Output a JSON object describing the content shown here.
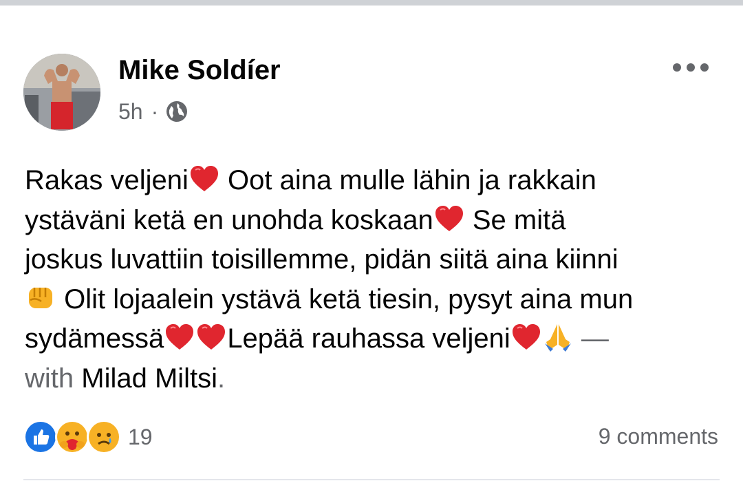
{
  "post": {
    "author": "Mike Soldíer",
    "time": "5h",
    "separator": "·",
    "privacy_icon": "globe-icon",
    "more_icon": "more-options-icon",
    "text_lines": [
      [
        "Rakas veljeni",
        "{heart}",
        " Oot aina mulle lähin ja rakkain"
      ],
      [
        "ystäväni ketä en unohda koskaan",
        "{heart}",
        " Se mitä"
      ],
      [
        "joskus luvattiin toisillemme, pidän siitä aina kiinni"
      ],
      [
        "{fist}",
        " Olit lojaalein ystävä ketä tiesin, pysyt aina mun"
      ],
      [
        "sydämessä",
        "{heart}",
        "{heart}",
        "Lepää rauhassa veljeni",
        "{heart}",
        "{pray}"
      ]
    ],
    "dash": " —",
    "with_label": "with",
    "tagged": "Milad Miltsi",
    "period": ".",
    "emoji_names": {
      "heart": "red-heart-emoji",
      "fist": "fist-emoji",
      "pray": "folded-hands-emoji"
    }
  },
  "footer": {
    "reaction_icons": [
      "like-reaction-icon",
      "care-reaction-icon",
      "sad-reaction-icon"
    ],
    "reaction_count": "19",
    "comments": "9 comments"
  },
  "colors": {
    "secondary_text": "#65676b",
    "like_blue": "#1b74e4",
    "heart_red": "#e0262f",
    "topbar": "#cfd2d6"
  }
}
